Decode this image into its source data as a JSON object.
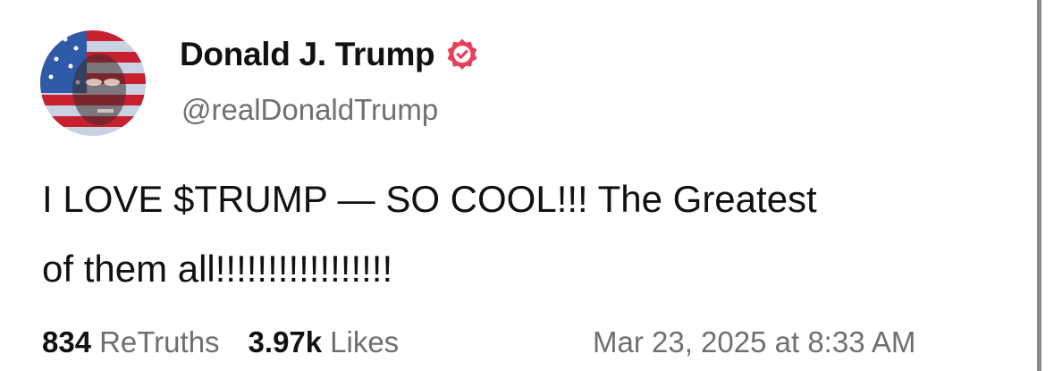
{
  "post": {
    "author": {
      "display_name": "Donald J. Trump",
      "handle": "@realDonaldTrump",
      "verified": true,
      "verified_icon": "verified-badge-icon",
      "avatar_icon": "profile-avatar"
    },
    "body_lines": [
      "I LOVE $TRUMP — SO COOL!!! The Greatest",
      "of them all!!!!!!!!!!!!!!!!!"
    ],
    "stats": {
      "retruths_count": "834",
      "retruths_label": "ReTruths",
      "likes_count": "3.97k",
      "likes_label": "Likes"
    },
    "timestamp": "Mar 23, 2025 at 8:33 AM"
  },
  "colors": {
    "text_primary": "#111111",
    "text_secondary": "#6f6f6f",
    "verified_badge": "#e8405a",
    "background": "#ffffff"
  }
}
